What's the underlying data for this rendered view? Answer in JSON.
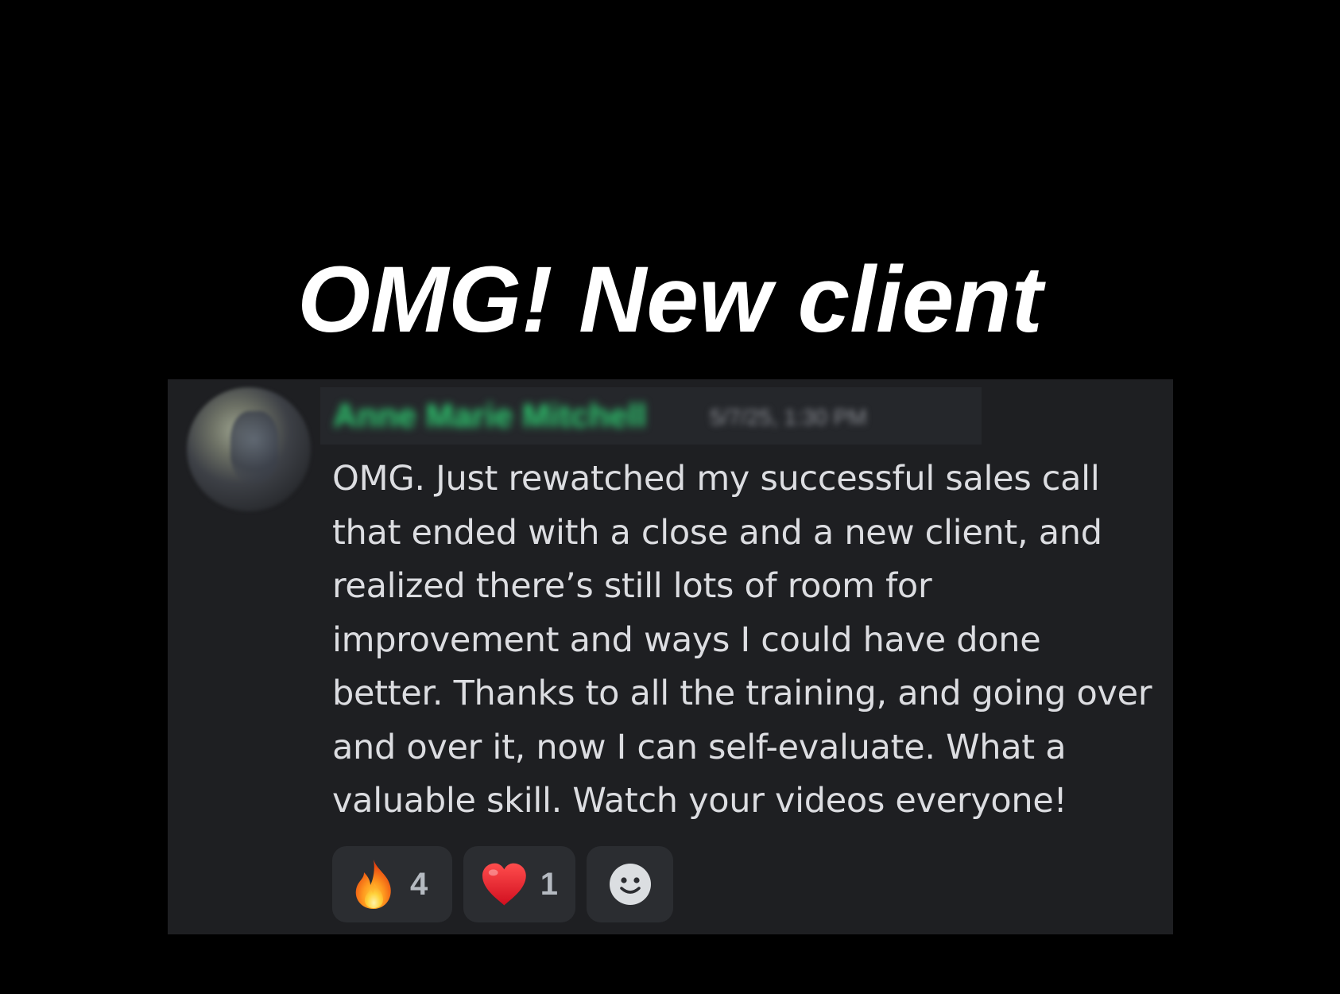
{
  "headline": "OMG! New client",
  "message": {
    "author": "Anne Marie Mitchell",
    "timestamp": "5/7/25, 1:30 PM",
    "text": "OMG. Just rewatched my successful sales call that ended with a close and a new client, and realized there’s still lots of room for improvement and ways I could have done better. Thanks to all the training, and going over and over it, now I can self-evaluate. What a valuable skill. Watch your videos everyone!",
    "author_color": "#2ecc71"
  },
  "reactions": [
    {
      "emoji": "fire-icon",
      "count": "4"
    },
    {
      "emoji": "red-heart-icon",
      "count": "1"
    }
  ],
  "add_reaction_icon": "smiley-face-icon",
  "colors": {
    "background": "#000000",
    "card": "#1e1f22",
    "reaction_pill": "#2b2d31",
    "text": "#dcdde1"
  }
}
